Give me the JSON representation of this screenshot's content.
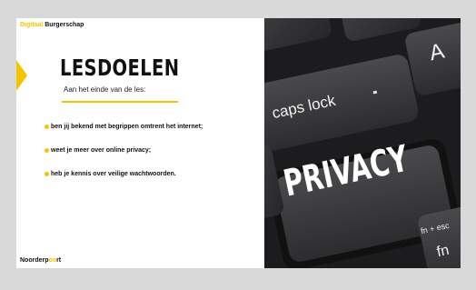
{
  "slide": {
    "brand_top_prefix": "Digitaal",
    "brand_top_suffix": "Burgerschap",
    "title": "LESDOELEN",
    "subtitle": "Aan het einde van de les:",
    "goals": [
      "ben jij bekend met begrippen omtrent het internet;",
      "weet je meer over online privacy;",
      "heb je kennis over veilige wachtwoorden."
    ],
    "brand_bottom_prefix": "Noorderp",
    "brand_bottom_accent": "oo",
    "brand_bottom_suffix": "rt"
  },
  "photo": {
    "keys": {
      "a": "A",
      "caps_lock": "caps lock",
      "privacy": "PRIVACY",
      "fn_esc": "fn + esc",
      "fn": "fn"
    }
  },
  "colors": {
    "accent": "#f5c400",
    "key": "#3a3a3c",
    "keyboard": "#1f1f21"
  }
}
